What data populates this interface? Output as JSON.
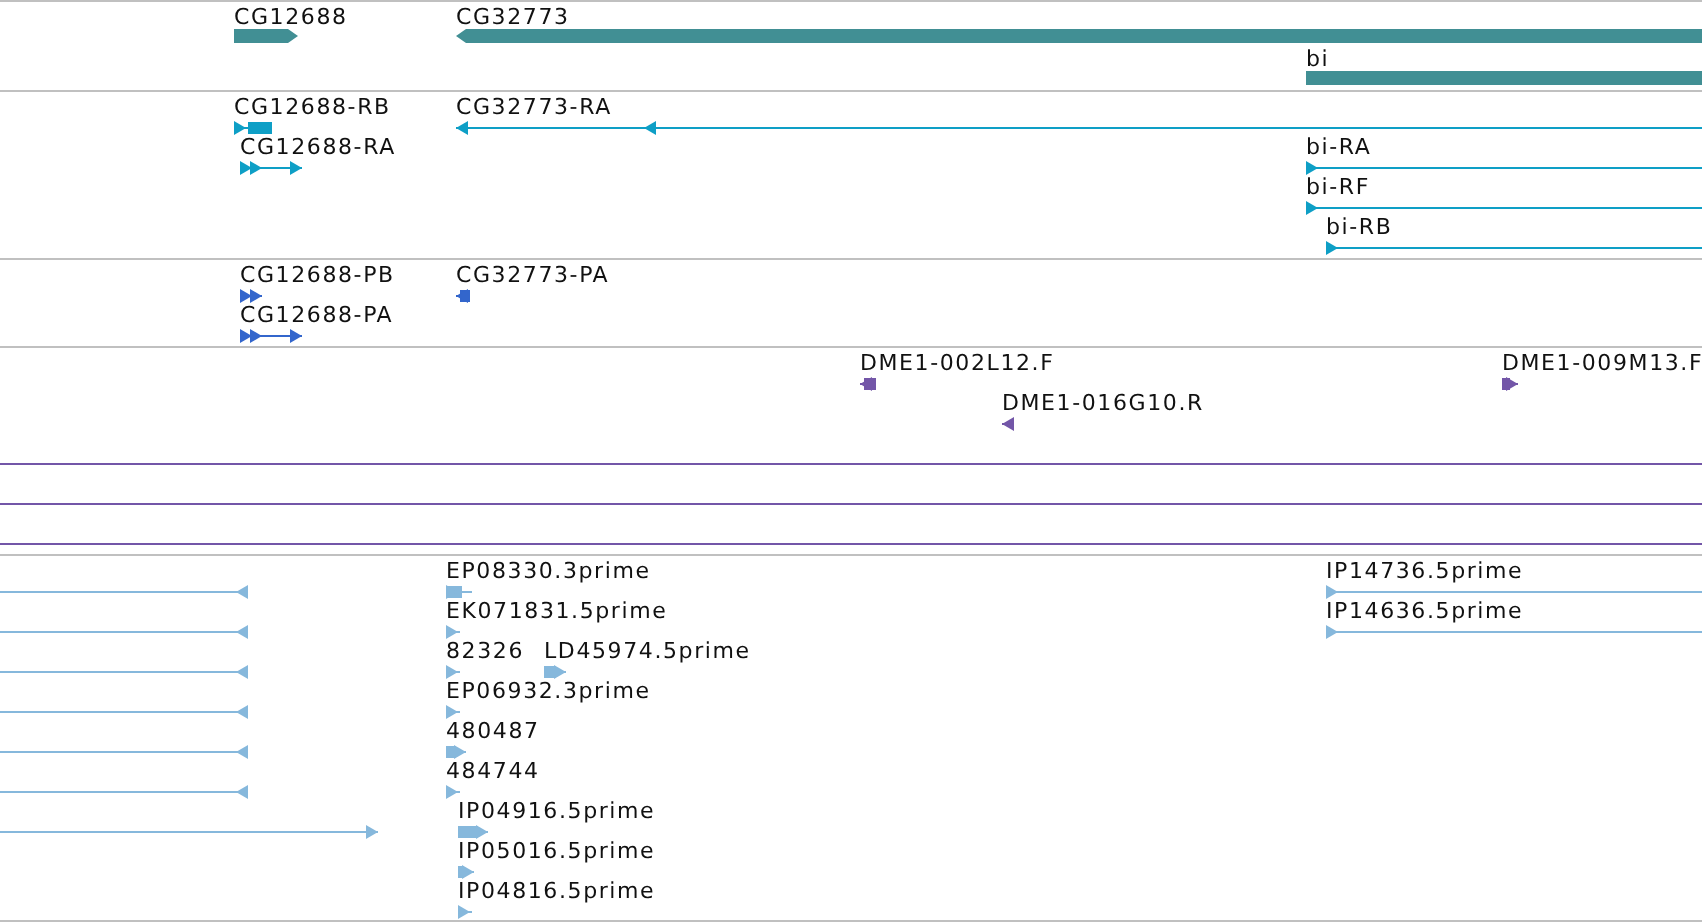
{
  "tracks": [
    {
      "kind": "gene",
      "color": "#418f94",
      "features": [
        {
          "label": "CG12688",
          "reverse": false
        },
        {
          "label": "CG32773",
          "reverse": true
        },
        {
          "label": "bi"
        }
      ]
    },
    {
      "kind": "transcript",
      "color": "#0e9fc6",
      "features": [
        {
          "label": "CG12688-RB",
          "reverse": false
        },
        {
          "label": "CG32773-RA",
          "reverse": true
        },
        {
          "label": "CG12688-RA",
          "reverse": false
        },
        {
          "label": "bi-RA",
          "reverse": false
        },
        {
          "label": "bi-RF",
          "reverse": false
        },
        {
          "label": "bi-RB",
          "reverse": false
        }
      ]
    },
    {
      "kind": "protein",
      "color": "#3366cc",
      "features": [
        {
          "label": "CG12688-PB",
          "reverse": false
        },
        {
          "label": "CG32773-PA",
          "reverse": true
        },
        {
          "label": "CG12688-PA",
          "reverse": false
        }
      ]
    },
    {
      "kind": "clone",
      "color": "#7356a8",
      "features": [
        {
          "kind": "read",
          "label": "DME1-002L12.F",
          "reverse": true
        },
        {
          "kind": "read",
          "label": "DME1-009M13.F",
          "reverse": false
        },
        {
          "kind": "read",
          "label": "DME1-016G10.R",
          "reverse": true
        },
        {
          "kind": "alignment"
        },
        {
          "kind": "alignment"
        },
        {
          "kind": "alignment"
        }
      ]
    },
    {
      "kind": "est",
      "color": "#86b8dc",
      "features": [
        {
          "reverse": true
        },
        {
          "reverse": true
        },
        {
          "reverse": true
        },
        {
          "reverse": true
        },
        {
          "reverse": true
        },
        {
          "reverse": true
        },
        {
          "reverse": false
        },
        {
          "label": "EP08330.3prime",
          "reverse": false
        },
        {
          "label": "EK071831.5prime",
          "reverse": false
        },
        {
          "label": "82326",
          "reverse": false
        },
        {
          "label": "LD45974.5prime",
          "reverse": false
        },
        {
          "label": "EP06932.3prime",
          "reverse": false
        },
        {
          "label": "480487",
          "reverse": false
        },
        {
          "label": "484744",
          "reverse": false
        },
        {
          "label": "IP04916.5prime",
          "reverse": false
        },
        {
          "label": "IP05016.5prime",
          "reverse": false
        },
        {
          "label": "IP04816.5prime",
          "reverse": false
        },
        {
          "label": "IP14736.5prime",
          "reverse": false
        },
        {
          "label": "IP14636.5prime",
          "reverse": false
        }
      ]
    }
  ]
}
